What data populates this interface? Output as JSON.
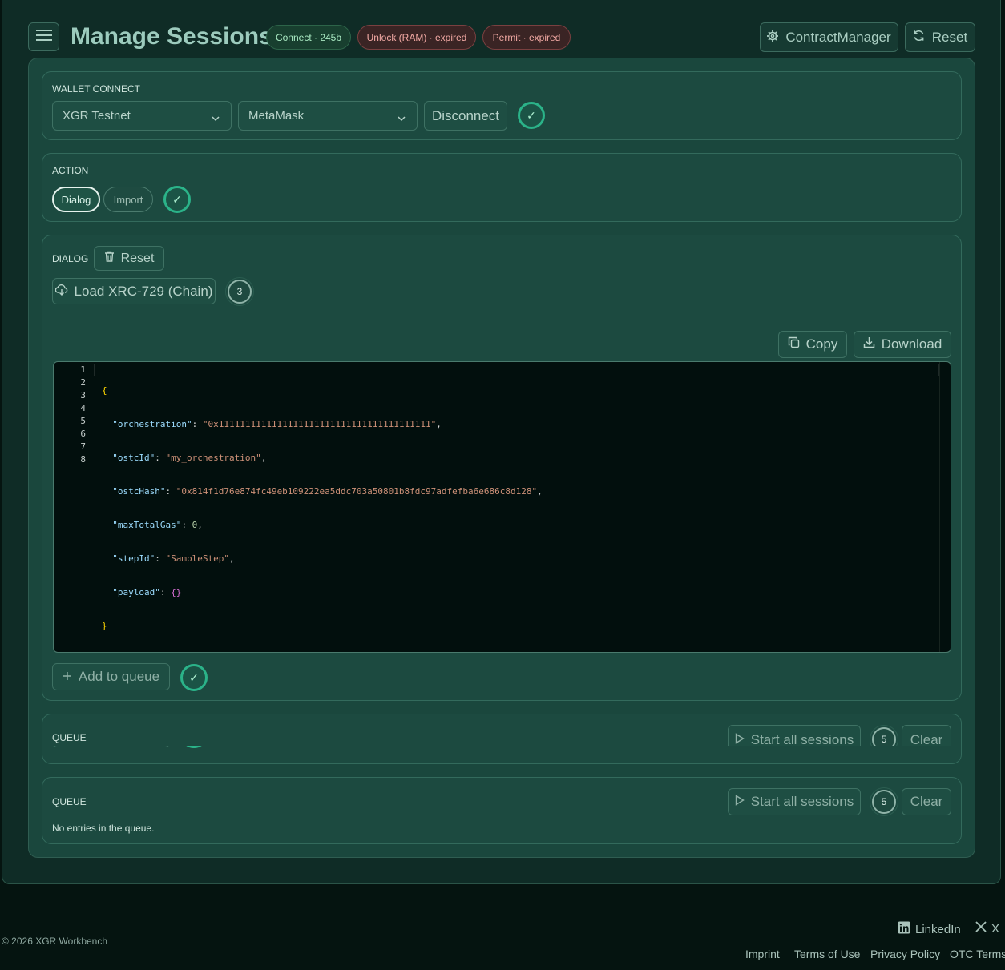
{
  "header": {
    "title": "Manage Sessions",
    "badges": {
      "connect": "Connect · 245b",
      "unlock": "Unlock (RAM) · expired",
      "permit": "Permit · expired"
    },
    "contract_manager_label": "ContractManager",
    "reset_label": "Reset"
  },
  "wallet": {
    "section_label": "WALLET CONNECT",
    "network_value": "XGR Testnet",
    "provider_value": "MetaMask",
    "disconnect_label": "Disconnect",
    "status_check": "✓"
  },
  "action": {
    "section_label": "ACTION",
    "tabs": [
      {
        "label": "Dialog",
        "active": true
      },
      {
        "label": "Import",
        "active": false
      }
    ],
    "status_check": "✓"
  },
  "dialog": {
    "section_label": "DIALOG",
    "reset_label": "Reset",
    "load_label": "Load XRC-729 (Chain)",
    "load_count": "3",
    "copy_label": "Copy",
    "download_label": "Download",
    "editor_line_numbers": [
      "1",
      "2",
      "3",
      "4",
      "5",
      "6",
      "7",
      "8"
    ],
    "editor": {
      "open_brace": "{",
      "close_brace": "}",
      "fields": [
        {
          "key": "\"orchestration\"",
          "value": "\"0x1111111111111111111111111111111111111111\"",
          "kind": "string",
          "comma": ","
        },
        {
          "key": "\"ostcId\"",
          "value": "\"my_orchestration\"",
          "kind": "string",
          "comma": ","
        },
        {
          "key": "\"ostcHash\"",
          "value": "\"0x814f1d76e874fc49eb109222ea5ddc703a50801b8fdc97adfefba6e686c8d128\"",
          "kind": "string",
          "comma": ","
        },
        {
          "key": "\"maxTotalGas\"",
          "value": "0",
          "kind": "number",
          "comma": ","
        },
        {
          "key": "\"stepId\"",
          "value": "\"SampleStep\"",
          "kind": "string",
          "comma": ","
        },
        {
          "key": "\"payload\"",
          "value": "{}",
          "kind": "object",
          "comma": ""
        }
      ]
    },
    "add_to_queue_label": "Add to queue",
    "status_check": "✓"
  },
  "queue_ghost": {
    "section_label": "QUEUE",
    "start_label": "Start all sessions",
    "count": "5",
    "clear_label": "Clear"
  },
  "queue": {
    "section_label": "QUEUE",
    "start_label": "Start all sessions",
    "count": "5",
    "clear_label": "Clear",
    "empty_text": "No entries in the queue."
  },
  "footer": {
    "copyright": "© 2026 XGR Workbench",
    "social": {
      "linkedin": "LinkedIn",
      "x": "X"
    },
    "links": [
      "Imprint",
      "Terms of Use",
      "Privacy Policy",
      "OTC Terms"
    ]
  },
  "colors": {
    "accent": "#2bb389",
    "background": "#051410",
    "panel": "#1a473d",
    "error_badge": "#3a2424"
  }
}
